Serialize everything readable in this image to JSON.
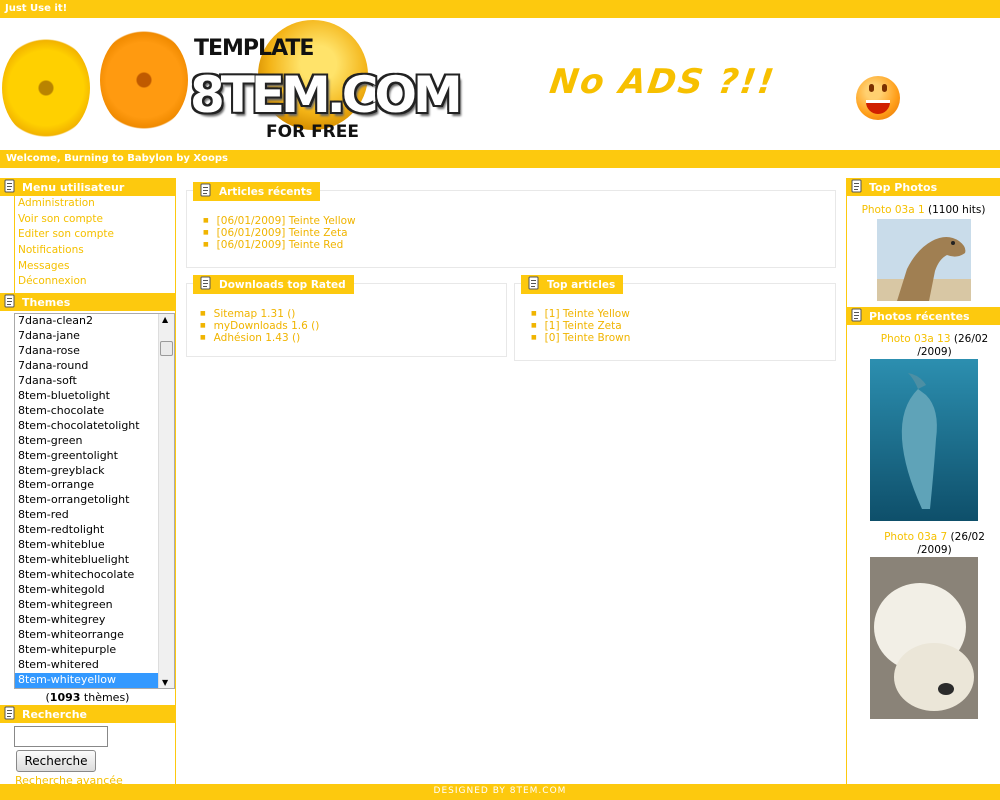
{
  "topbar": {
    "text": "Just Use it!"
  },
  "header": {
    "logo_template": "TEMPLATE",
    "logo_main": "8TEM.COM",
    "logo_free": "FOR FREE",
    "noads": "No ADS ?!!"
  },
  "welcome": {
    "text": "Welcome, Burning to Babylon by Xoops"
  },
  "usermenu": {
    "title": "Menu utilisateur",
    "items": [
      "Administration",
      "Voir son compte",
      "Editer son compte",
      "Notifications",
      "Messages",
      "Déconnexion"
    ]
  },
  "themes": {
    "title": "Themes",
    "items": [
      "7dana-clean2",
      "7dana-jane",
      "7dana-rose",
      "7dana-round",
      "7dana-soft",
      "8tem-bluetolight",
      "8tem-chocolate",
      "8tem-chocolatetolight",
      "8tem-green",
      "8tem-greentolight",
      "8tem-greyblack",
      "8tem-orrange",
      "8tem-orrangetolight",
      "8tem-red",
      "8tem-redtolight",
      "8tem-whiteblue",
      "8tem-whitebluelight",
      "8tem-whitechocolate",
      "8tem-whitegold",
      "8tem-whitegreen",
      "8tem-whitegrey",
      "8tem-whiteorrange",
      "8tem-whitepurple",
      "8tem-whitered",
      "8tem-whiteyellow"
    ],
    "selected": "8tem-whiteyellow",
    "count_open": "(",
    "count": "1093",
    "count_close": " thèmes)"
  },
  "search": {
    "title": "Recherche",
    "input_value": "",
    "button_label": "Recherche",
    "advanced": "Recherche avancée"
  },
  "articles_recent": {
    "title": "Articles récents",
    "items": [
      "[06/01/2009] Teinte Yellow",
      "[06/01/2009] Teinte Zeta",
      "[06/01/2009] Teinte Red"
    ]
  },
  "downloads_top": {
    "title": "Downloads top Rated",
    "items": [
      "Sitemap 1.31 ()",
      "myDownloads 1.6 ()",
      "Adhésion 1.43 ()"
    ]
  },
  "top_articles": {
    "title": "Top articles",
    "items": [
      "[1] Teinte Yellow",
      "[1] Teinte Zeta",
      "[0] Teinte Brown"
    ]
  },
  "top_photos": {
    "title": "Top Photos",
    "photo_link": "Photo 03a 1",
    "photo_info": " (1100 hits)"
  },
  "recent_photos": {
    "title": "Photos récentes",
    "photos": [
      {
        "link": "Photo 03a 13",
        "date_part1": " (26/02",
        "date_part2": "/2009)"
      },
      {
        "link": "Photo 03a 7",
        "date_part1": " (26/02",
        "date_part2": "/2009)"
      }
    ]
  },
  "footer": {
    "text": "DESIGNED BY 8TEM.COM"
  },
  "colors": {
    "accent": "#fdc90e",
    "link": "#f0b400",
    "selected": "#3399ff"
  }
}
